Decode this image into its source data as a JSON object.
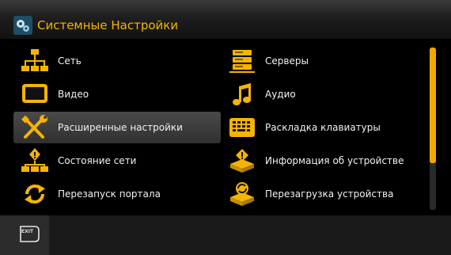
{
  "header": {
    "title": "Системные Настройки",
    "icon": "gears-icon"
  },
  "accent_color": "#f5b400",
  "menu": {
    "left": [
      {
        "label": "Сеть",
        "icon": "network-icon"
      },
      {
        "label": "Видео",
        "icon": "monitor-icon"
      },
      {
        "label": "Расширенные настройки",
        "icon": "tools-icon",
        "selected": true
      },
      {
        "label": "Состояние сети",
        "icon": "network-status-icon"
      },
      {
        "label": "Перезапуск портала",
        "icon": "restart-icon"
      }
    ],
    "right": [
      {
        "label": "Серверы",
        "icon": "servers-icon"
      },
      {
        "label": "Аудио",
        "icon": "music-note-icon"
      },
      {
        "label": "Раскладка клавиатуры",
        "icon": "keyboard-icon"
      },
      {
        "label": "Информация об устройстве",
        "icon": "device-info-icon"
      },
      {
        "label": "Перезагрузка устройства",
        "icon": "device-reboot-icon"
      }
    ]
  },
  "footer": {
    "exit_label": "EXIT",
    "icon": "exit-button-icon"
  }
}
